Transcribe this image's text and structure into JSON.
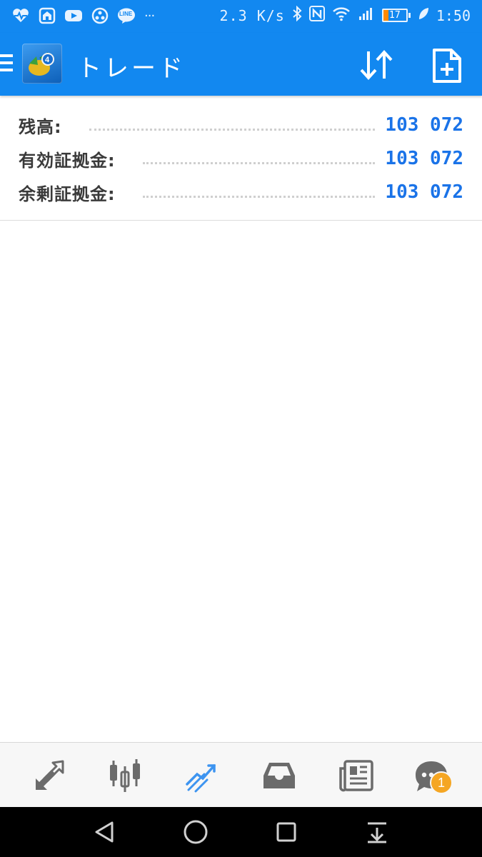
{
  "status_bar": {
    "net_speed": "2.3 K/s",
    "battery_level": "17",
    "time": "1:50",
    "icons_left": [
      "heart-rate-icon",
      "home-app-icon",
      "youtube-icon",
      "dots-app-icon",
      "line-icon",
      "more-notifications-icon"
    ],
    "icons_right": [
      "bluetooth-icon",
      "nfc-icon",
      "wifi-icon",
      "signal-icon",
      "battery-icon",
      "leaf-icon"
    ],
    "line_label": "LINE",
    "more_label": "···"
  },
  "app_bar": {
    "title": "トレード",
    "menu_icon": "hamburger-icon",
    "logo": "metatrader4-logo",
    "actions": [
      "sort-icon",
      "new-order-icon"
    ]
  },
  "account_summary": [
    {
      "label": "残高:",
      "value": "103 072"
    },
    {
      "label": "有効証拠金:",
      "value": "103 072"
    },
    {
      "label": "余剰証拠金:",
      "value": "103 072"
    }
  ],
  "bottom_nav": {
    "items": [
      {
        "name": "quotes",
        "icon": "quotes-arrows-icon"
      },
      {
        "name": "chart",
        "icon": "candlestick-icon"
      },
      {
        "name": "trade",
        "icon": "trade-lines-icon",
        "active": true
      },
      {
        "name": "history",
        "icon": "inbox-tray-icon"
      },
      {
        "name": "news",
        "icon": "newspaper-icon"
      },
      {
        "name": "messages",
        "icon": "chat-icon",
        "badge": "1"
      }
    ]
  },
  "colors": {
    "primary": "#1288f0",
    "value_blue": "#1a73e8",
    "active_tab": "#3d94f0",
    "inactive_tab": "#6b6b6b",
    "badge": "#f5a623"
  }
}
